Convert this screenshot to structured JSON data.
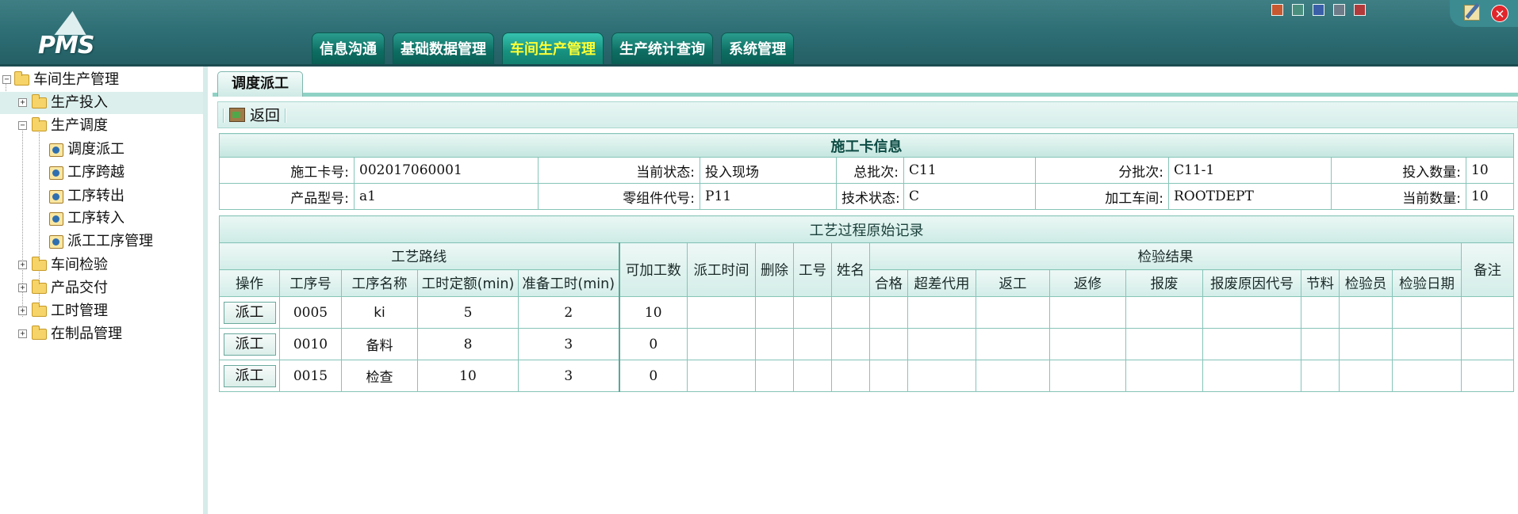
{
  "app": {
    "logo_text": "PMS"
  },
  "header": {
    "tabs": [
      {
        "label": "信息沟通",
        "active": false
      },
      {
        "label": "基础数据管理",
        "active": false
      },
      {
        "label": "车间生产管理",
        "active": true
      },
      {
        "label": "生产统计查询",
        "active": false
      },
      {
        "label": "系统管理",
        "active": false
      }
    ],
    "theme_colors": [
      "#c8582f",
      "#4a8f7e",
      "#3a5fa8",
      "#6d7c88",
      "#b23a3a"
    ]
  },
  "sidebar": {
    "root": "车间生产管理",
    "items": [
      {
        "label": "生产投入",
        "expanded": false,
        "selected": true
      },
      {
        "label": "生产调度",
        "expanded": true,
        "selected": false,
        "children": [
          "调度派工",
          "工序跨越",
          "工序转出",
          "工序转入",
          "派工工序管理"
        ]
      },
      {
        "label": "车间检验",
        "expanded": false
      },
      {
        "label": "产品交付",
        "expanded": false
      },
      {
        "label": "工时管理",
        "expanded": false
      },
      {
        "label": "在制品管理",
        "expanded": false
      }
    ]
  },
  "main": {
    "tab_label": "调度派工",
    "toolbar": {
      "back_label": "返回"
    },
    "card_info": {
      "title": "施工卡信息",
      "row1": [
        {
          "label": "施工卡号:",
          "value": "002017060001"
        },
        {
          "label": "当前状态:",
          "value": "投入现场"
        },
        {
          "label": "总批次:",
          "value": "C11"
        },
        {
          "label": "分批次:",
          "value": "C11-1"
        },
        {
          "label": "投入数量:",
          "value": "10"
        }
      ],
      "row2": [
        {
          "label": "产品型号:",
          "value": "a1"
        },
        {
          "label": "零组件代号:",
          "value": "P11"
        },
        {
          "label": "技术状态:",
          "value": "C"
        },
        {
          "label": "加工车间:",
          "value": "ROOTDEPT"
        },
        {
          "label": "当前数量:",
          "value": "10"
        }
      ]
    },
    "process": {
      "title": "工艺过程原始记录",
      "group_route": "工艺路线",
      "group_inspect": "检验结果",
      "headers": {
        "op": "操作",
        "no": "工序号",
        "name": "工序名称",
        "quota": "工时定额(min)",
        "prep": "准备工时(min)",
        "avail": "可加工数",
        "time": "派工时间",
        "del": "删除",
        "worker_no": "工号",
        "worker_name": "姓名",
        "pass": "合格",
        "over": "超差代用",
        "rework": "返工",
        "repair": "返修",
        "scrap": "报废",
        "scrap_code": "报废原因代号",
        "saving": "节料",
        "inspector": "检验员",
        "inspect_date": "检验日期",
        "remark": "备注"
      },
      "rows": [
        {
          "action": "派工",
          "no": "0005",
          "name": "ki",
          "quota": "5",
          "prep": "2",
          "avail": "10"
        },
        {
          "action": "派工",
          "no": "0010",
          "name": "备料",
          "quota": "8",
          "prep": "3",
          "avail": "0"
        },
        {
          "action": "派工",
          "no": "0015",
          "name": "检查",
          "quota": "10",
          "prep": "3",
          "avail": "0"
        }
      ]
    }
  }
}
